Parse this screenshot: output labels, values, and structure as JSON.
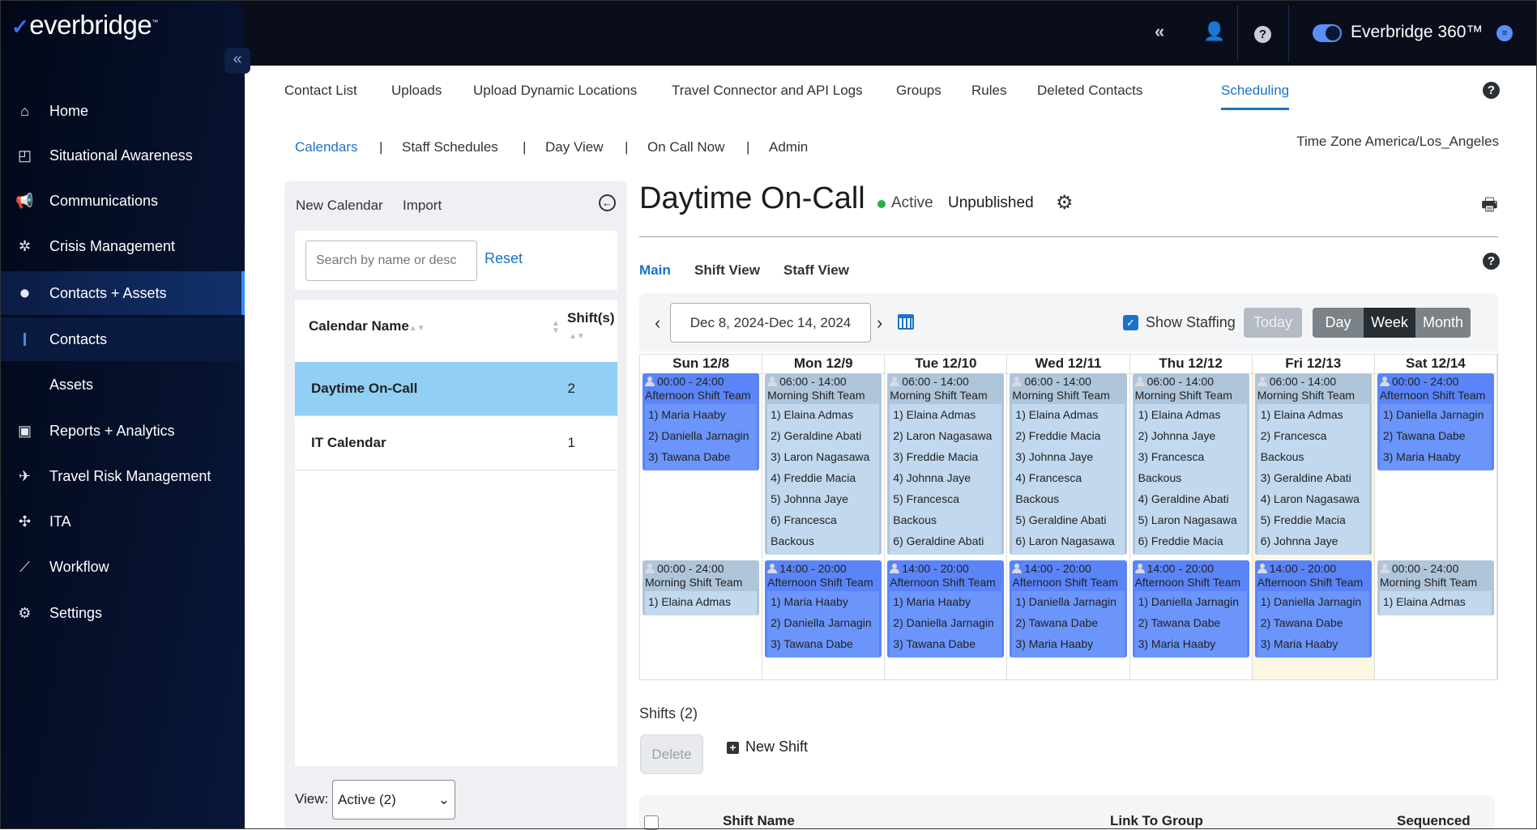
{
  "brand": {
    "logo": "everbridge",
    "product": "Everbridge 360™"
  },
  "sidebar": {
    "items": [
      {
        "label": "Home",
        "icon": "home-icon",
        "glyph": "⌂"
      },
      {
        "label": "Situational Awareness",
        "icon": "map-icon",
        "glyph": "◰"
      },
      {
        "label": "Communications",
        "icon": "megaphone-icon",
        "glyph": "📢"
      },
      {
        "label": "Crisis Management",
        "icon": "crisis-icon",
        "glyph": "✲"
      },
      {
        "label": "Contacts + Assets",
        "icon": "location-pin-icon",
        "glyph": "⬤",
        "active": true
      },
      {
        "label": "Contacts",
        "sub": true
      },
      {
        "label": "Assets",
        "sub2": true
      },
      {
        "label": "Reports + Analytics",
        "icon": "report-icon",
        "glyph": "▣"
      },
      {
        "label": "Travel Risk Management",
        "icon": "airplane-icon",
        "glyph": "✈"
      },
      {
        "label": "ITA",
        "icon": "ita-icon",
        "glyph": "✣"
      },
      {
        "label": "Workflow",
        "icon": "chart-line-icon",
        "glyph": "⟋"
      },
      {
        "label": "Settings",
        "icon": "gear-icon",
        "glyph": "⚙"
      }
    ]
  },
  "nav": {
    "tabs": [
      "Contact List",
      "Uploads",
      "Upload Dynamic Locations",
      "Travel Connector and API Logs",
      "Groups",
      "Rules",
      "Deleted Contacts",
      "Scheduling"
    ],
    "active": "Scheduling"
  },
  "subnav": {
    "tabs": [
      "Calendars",
      "Staff Schedules",
      "Day View",
      "On Call Now",
      "Admin"
    ],
    "active": "Calendars",
    "timezone": "Time Zone America/Los_Angeles"
  },
  "left_panel": {
    "new_calendar": "New Calendar",
    "import": "Import",
    "search_placeholder": "Search by name or desc",
    "reset": "Reset",
    "col_name": "Calendar Name",
    "col_shifts": "Shift(s)",
    "calendars": [
      {
        "name": "Daytime On-Call",
        "shifts": "2",
        "selected": true
      },
      {
        "name": "IT Calendar",
        "shifts": "1"
      }
    ],
    "view_label": "View:",
    "view_value": "Active (2)"
  },
  "calendar": {
    "title": "Daytime On-Call",
    "status": "Active",
    "publish_state": "Unpublished",
    "status_color": "#22b14c",
    "tabs": [
      "Main",
      "Shift View",
      "Staff View"
    ],
    "active_tab": "Main",
    "date_range": "Dec 8, 2024-Dec 14, 2024",
    "show_staffing": "Show Staffing",
    "show_staffing_checked": true,
    "today": "Today",
    "views": [
      "Day",
      "Week",
      "Month"
    ],
    "active_view": "Week",
    "days": [
      {
        "label": "Sun 12/8",
        "events": [
          {
            "time": "00:00 - 24:00",
            "team": "Afternoon Shift Team",
            "type": "aft",
            "members": [
              "1) Maria Haaby",
              "2) Daniella Jarnagin",
              "3) Tawana Dabe"
            ]
          },
          {
            "time": "00:00 - 24:00",
            "team": "Morning Shift Team",
            "type": "mor",
            "members": [
              "1) Elaina Admas"
            ]
          }
        ]
      },
      {
        "label": "Mon 12/9",
        "events": [
          {
            "time": "06:00 - 14:00",
            "team": "Morning Shift Team",
            "type": "mor",
            "members": [
              "1) Elaina Admas",
              "2) Geraldine Abati",
              "3) Laron Nagasawa",
              "4) Freddie Macia",
              "5) Johnna Jaye",
              "6) Francesca Backous"
            ]
          },
          {
            "time": "14:00 - 20:00",
            "team": "Afternoon Shift Team",
            "type": "aft",
            "members": [
              "1) Maria Haaby",
              "2) Daniella Jarnagin",
              "3) Tawana Dabe"
            ]
          }
        ]
      },
      {
        "label": "Tue 12/10",
        "events": [
          {
            "time": "06:00 - 14:00",
            "team": "Morning Shift Team",
            "type": "mor",
            "members": [
              "1) Elaina Admas",
              "2) Laron Nagasawa",
              "3) Freddie Macia",
              "4) Johnna Jaye",
              "5) Francesca Backous",
              "6) Geraldine Abati"
            ]
          },
          {
            "time": "14:00 - 20:00",
            "team": "Afternoon Shift Team",
            "type": "aft",
            "members": [
              "1) Maria Haaby",
              "2) Daniella Jarnagin",
              "3) Tawana Dabe"
            ]
          }
        ]
      },
      {
        "label": "Wed 12/11",
        "events": [
          {
            "time": "06:00 - 14:00",
            "team": "Morning Shift Team",
            "type": "mor",
            "members": [
              "1) Elaina Admas",
              "2) Freddie Macia",
              "3) Johnna Jaye",
              "4) Francesca Backous",
              "5) Geraldine Abati",
              "6) Laron Nagasawa"
            ]
          },
          {
            "time": "14:00 - 20:00",
            "team": "Afternoon Shift Team",
            "type": "aft",
            "members": [
              "1) Daniella Jarnagin",
              "2) Tawana Dabe",
              "3) Maria Haaby"
            ]
          }
        ]
      },
      {
        "label": "Thu 12/12",
        "events": [
          {
            "time": "06:00 - 14:00",
            "team": "Morning Shift Team",
            "type": "mor",
            "members": [
              "1) Elaina Admas",
              "2) Johnna Jaye",
              "3) Francesca Backous",
              "4) Geraldine Abati",
              "5) Laron Nagasawa",
              "6) Freddie Macia"
            ]
          },
          {
            "time": "14:00 - 20:00",
            "team": "Afternoon Shift Team",
            "type": "aft",
            "members": [
              "1) Daniella Jarnagin",
              "2) Tawana Dabe",
              "3) Maria Haaby"
            ]
          }
        ]
      },
      {
        "label": "Fri 12/13",
        "today": true,
        "events": [
          {
            "time": "06:00 - 14:00",
            "team": "Morning Shift Team",
            "type": "mor",
            "members": [
              "1) Elaina Admas",
              "2) Francesca Backous",
              "3) Geraldine Abati",
              "4) Laron Nagasawa",
              "5) Freddie Macia",
              "6) Johnna Jaye"
            ]
          },
          {
            "time": "14:00 - 20:00",
            "team": "Afternoon Shift Team",
            "type": "aft",
            "members": [
              "1) Daniella Jarnagin",
              "2) Tawana Dabe",
              "3) Maria Haaby"
            ]
          }
        ]
      },
      {
        "label": "Sat 12/14",
        "events": [
          {
            "time": "00:00 - 24:00",
            "team": "Afternoon Shift Team",
            "type": "aft",
            "members": [
              "1) Daniella Jarnagin",
              "2) Tawana Dabe",
              "3) Maria Haaby"
            ]
          },
          {
            "time": "00:00 - 24:00",
            "team": "Morning Shift Team",
            "type": "mor",
            "members": [
              "1) Elaina Admas"
            ]
          }
        ]
      }
    ]
  },
  "shifts": {
    "title": "Shifts (2)",
    "delete": "Delete",
    "new_shift": "New Shift",
    "columns": [
      "Shift Name",
      "Link To Group",
      "Sequenced"
    ]
  },
  "colors": {
    "accent": "#1a73c8",
    "afternoon_event": "#5a84f8",
    "morning_event": "#afc5da",
    "selected_row": "#92cff5",
    "today_column": "#fdf6e1"
  }
}
